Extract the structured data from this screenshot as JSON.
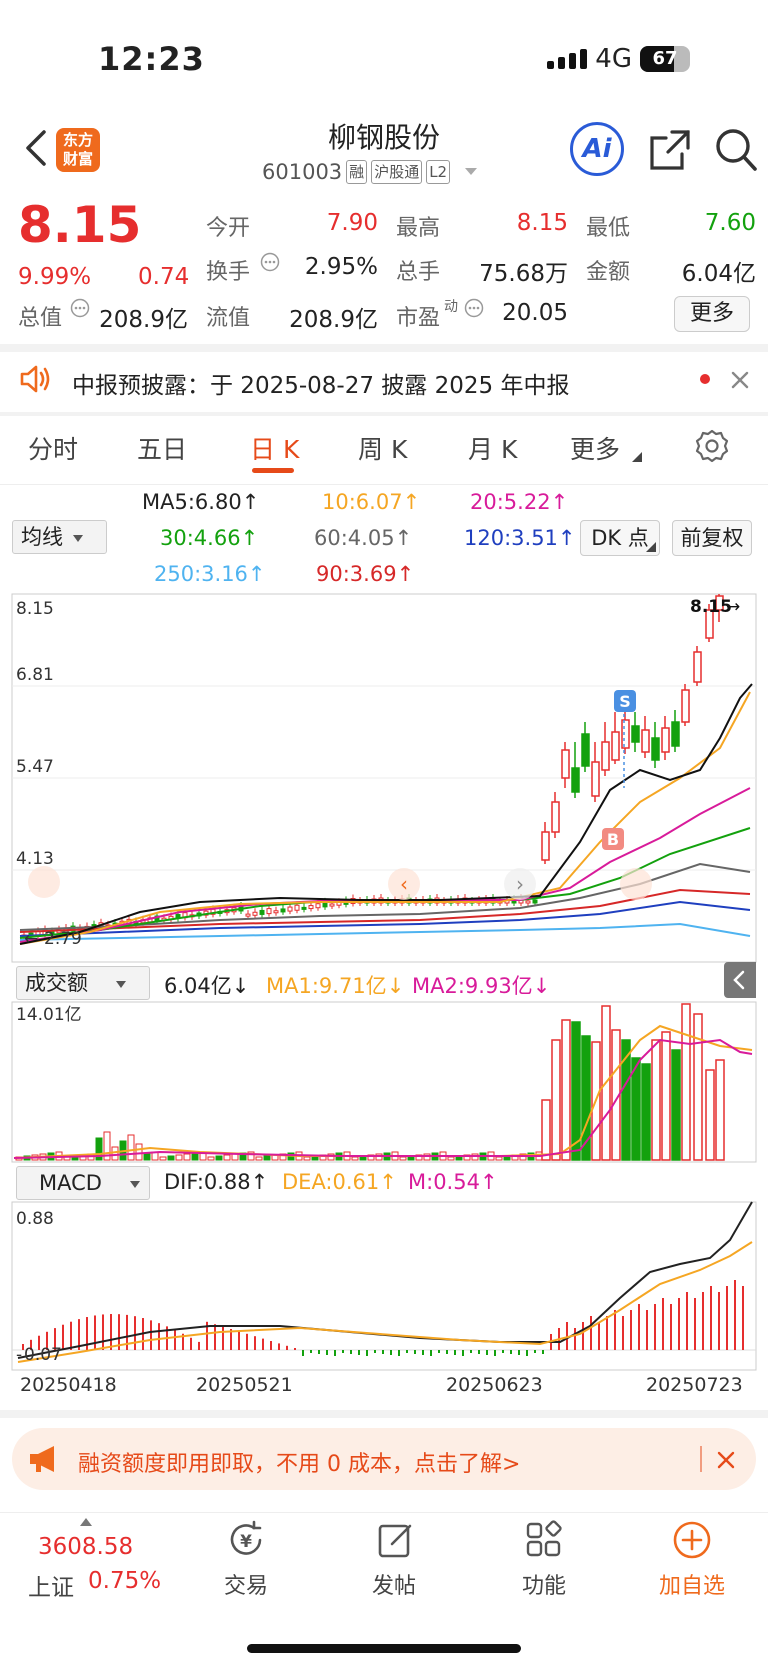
{
  "status": {
    "time": "12:23",
    "network": "4G",
    "battery": "67",
    "battery_level": 0.67
  },
  "header": {
    "logo_line1": "东方",
    "logo_line2": "财富",
    "name": "柳钢股份",
    "code": "601003",
    "tags": [
      "融",
      "沪股通",
      "L2"
    ],
    "ai_label": "Ai"
  },
  "quote": {
    "price": "8.15",
    "change_pct": "9.99%",
    "change": "0.74",
    "open_label": "今开",
    "open": "7.90",
    "high_label": "最高",
    "high": "8.15",
    "low_label": "最低",
    "low": "7.60",
    "turnover_label": "换手",
    "turnover": "2.95%",
    "volume_label": "总手",
    "volume": "75.68万",
    "amount_label": "金额",
    "amount": "6.04亿",
    "mcap_label": "总值",
    "mcap": "208.9亿",
    "float_label": "流值",
    "float_mcap": "208.9亿",
    "pe_label": "市盈",
    "pe_sup": "动",
    "pe": "20.05",
    "more_label": "更多"
  },
  "notice": {
    "text": "中报预披露：于 2025-08-27 披露 2025 年中报"
  },
  "tabs": [
    "分时",
    "五日",
    "日 K",
    "周 K",
    "月 K",
    "更多"
  ],
  "active_tab": "日 K",
  "ma_legend": {
    "selector": "均线",
    "ma5": "MA5:6.80",
    "ma10": "10:6.07",
    "ma20": "20:5.22",
    "ma30": "30:4.66",
    "ma60": "60:4.05",
    "ma120": "120:3.51",
    "ma250": "250:3.16",
    "ma90": "90:3.69",
    "arrow": "↑",
    "dk_label": "DK 点",
    "fq_label": "前复权",
    "colors": {
      "ma5": "#111111",
      "ma10": "#f5a623",
      "ma20": "#d81b9a",
      "ma30": "#13a10e",
      "ma60": "#666666",
      "ma120": "#1f3fbf",
      "ma250": "#4fb3f0",
      "ma90": "#d62828"
    }
  },
  "kline": {
    "y_labels": [
      "8.15",
      "6.81",
      "5.47",
      "4.13"
    ],
    "last_label": "8.15",
    "low_label": "2.79",
    "buy_marker": "B",
    "sell_marker": "S"
  },
  "volume_panel": {
    "selector": "成交额",
    "value": "6.04亿",
    "ma1": "MA1:9.71亿",
    "ma2": "MA2:9.93亿",
    "down_arrow": "↓",
    "top_label": "14.01亿"
  },
  "macd_panel": {
    "selector": "MACD",
    "dif": "DIF:0.88",
    "dea": "DEA:0.61",
    "m": "M:0.54",
    "up_arrow": "↑",
    "top_label": "0.88",
    "low_label": "0.07"
  },
  "dates": [
    "20250418",
    "20250521",
    "20250623",
    "20250723"
  ],
  "banner": {
    "text": "融资额度即用即取，不用 0 成本，点击了解>"
  },
  "bottom": {
    "index_value": "3608.58",
    "index_name": "上证",
    "index_change": "0.75%",
    "nav": [
      "交易",
      "发帖",
      "功能",
      "加自选"
    ]
  }
}
